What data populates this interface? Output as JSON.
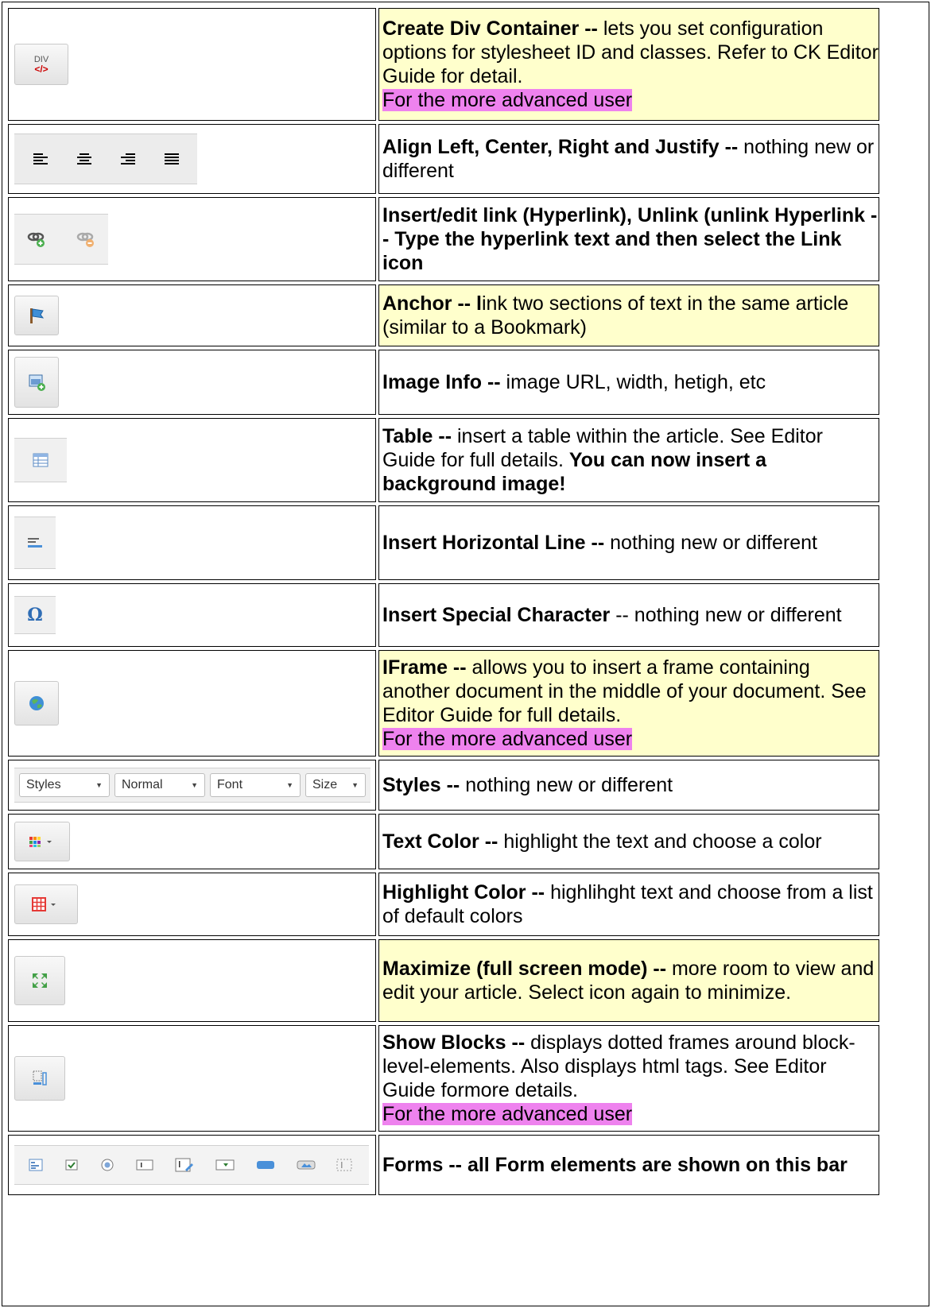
{
  "colors": {
    "yellow_cell": "#ffffcc",
    "magenta_highlight": "#ee82ee",
    "border": "#000000"
  },
  "advanced_note": "For the more advanced user",
  "rows": [
    {
      "icon": "div-container-icon",
      "title": "Create Div Container --",
      "desc": " lets you set configuration options for stylesheet ID and classes. Refer to CK Editor Guide for detail.",
      "icon_text": "DIV"
    },
    {
      "icon": "align-icons",
      "title": "Align Left, Center, Right and Justify --",
      "desc": " nothing new or different"
    },
    {
      "icon": "link-unlink-icons",
      "title": "Insert/edit link (Hyperlink), Unlink (unlink Hyperlink  -- Type the hyperlink text and then select the Link icon"
    },
    {
      "icon": "anchor-flag-icon",
      "title": "Anchor -- l",
      "desc": "ink two sections of text in the same article (similar to a Bookmark)"
    },
    {
      "icon": "image-icon",
      "title": "Image Info --",
      "desc": " image URL, width, hetigh, etc"
    },
    {
      "icon": "table-icon",
      "title": "Table --",
      "desc": " insert a table within the article.  See Editor Guide for full details.  ",
      "bold_tail": "You can now insert a background image!"
    },
    {
      "icon": "horizontal-line-icon",
      "title": "Insert Horizontal Line --",
      "desc": " nothing new or different"
    },
    {
      "icon": "omega-icon",
      "title": "Insert Special Character",
      "desc": " -- nothing new or different",
      "icon_text": "Ω"
    },
    {
      "icon": "globe-icon",
      "title": "IFrame --",
      "desc": " allows you to insert a frame containing another document in the middle of your document. See Editor Guide for full details."
    },
    {
      "icon": "style-combos",
      "title": "Styles --",
      "desc": " nothing new or different",
      "combos": [
        "Styles",
        "Normal",
        "Font",
        "Size"
      ]
    },
    {
      "icon": "text-color-icon",
      "title": "Text Color --",
      "desc": " highlight the text and choose a color"
    },
    {
      "icon": "highlight-color-icon",
      "title": "Highlight Color --",
      "desc": " highlihght text and choose from a list of default colors"
    },
    {
      "icon": "maximize-icon",
      "title": "Maximize (full screen mode)  --",
      "desc": " more room to view and edit your article. Select icon again to minimize."
    },
    {
      "icon": "show-blocks-icon",
      "title": "Show Blocks --",
      "desc": " displays dotted frames around block-level-elements.  Also displays html tags.  See Editor Guide formore details."
    },
    {
      "icon": "form-elements-icons",
      "title": "Forms -- all Form elements are shown on this bar"
    }
  ]
}
